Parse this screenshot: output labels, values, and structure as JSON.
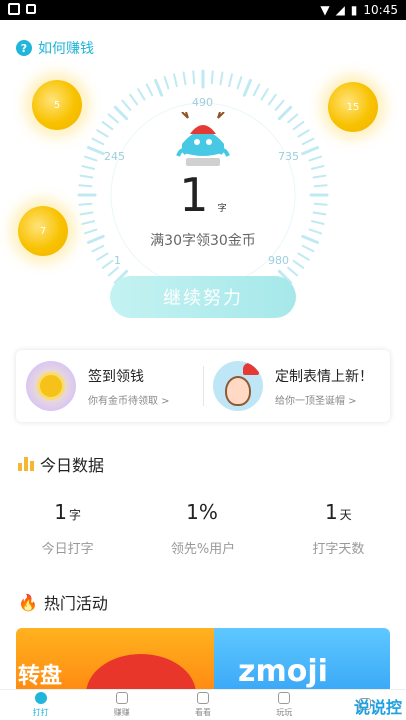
{
  "status_bar": {
    "time": "10:45"
  },
  "help": {
    "label": "如何赚钱"
  },
  "gauge": {
    "ticks": [
      "1",
      "245",
      "490",
      "735",
      "980"
    ],
    "count": "1",
    "count_unit": "字",
    "goal_text": "满30字领30金币",
    "coins": [
      "5",
      "15",
      "7"
    ]
  },
  "primary_button": {
    "label": "继续努力"
  },
  "cards": [
    {
      "title": "签到领钱",
      "subtitle": "你有金币待领取 >"
    },
    {
      "title": "定制表情上新！",
      "subtitle": "给你一顶圣诞帽 >"
    }
  ],
  "today": {
    "title": "今日数据",
    "stats": [
      {
        "value": "1",
        "unit": "字",
        "label": "今日打字"
      },
      {
        "value": "1%",
        "unit": "",
        "label": "领先%用户"
      },
      {
        "value": "1",
        "unit": "天",
        "label": "打字天数"
      }
    ]
  },
  "hot": {
    "title": "热门活动",
    "banner_left": "转盘",
    "banner_right": "zmoji"
  },
  "nav": [
    {
      "label": "打打"
    },
    {
      "label": "赚赚"
    },
    {
      "label": "看看"
    },
    {
      "label": "玩玩"
    }
  ],
  "watermark": "说说控",
  "colors": {
    "accent": "#1fb6d9",
    "coin": "#f8c200"
  }
}
